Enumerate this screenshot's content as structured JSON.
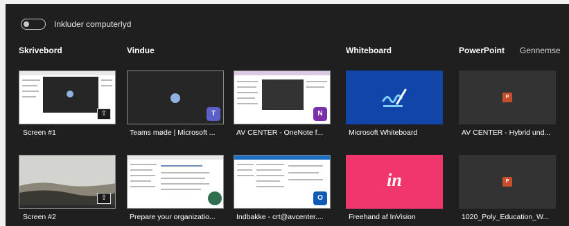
{
  "toggle": {
    "label": "Inkluder computerlyd",
    "on": false
  },
  "categories": {
    "desktop": "Skrivebord",
    "window": "Vindue",
    "whiteboard": "Whiteboard",
    "powerpoint": "PowerPoint",
    "browse": "Gennemse"
  },
  "tiles": {
    "screen1": "Screen #1",
    "screen2": "Screen #2",
    "teams": "Teams møde | Microsoft ...",
    "outlook": "Prepare your organizatio...",
    "onenote": "AV CENTER - OneNote f...",
    "indbakke": "Indbakke - crt@avcenter....",
    "whiteboard": "Microsoft Whiteboard",
    "freehand": "Freehand af InVision",
    "ppt1": "AV CENTER - Hybrid und...",
    "ppt2": "1020_Poly_Education_W..."
  },
  "icons": {
    "share": "share-screen-icon",
    "teams": "teams-icon",
    "onenote": "onenote-icon",
    "outlook": "outlook-icon",
    "whiteboard": "whiteboard-icon",
    "invision": "invision-icon",
    "powerpoint": "powerpoint-icon"
  },
  "badges": {
    "teams": "T",
    "onenote": "N",
    "outlook": "O",
    "invision": "in",
    "powerpoint": "P"
  },
  "colors": {
    "panel": "#1f1f1f",
    "whiteboard": "#1245a8",
    "invision": "#f0366b",
    "teams": "#5b5fc7",
    "onenote": "#7b2fa8",
    "outlook": "#0f5bb5",
    "powerpoint": "#c94f2c"
  }
}
